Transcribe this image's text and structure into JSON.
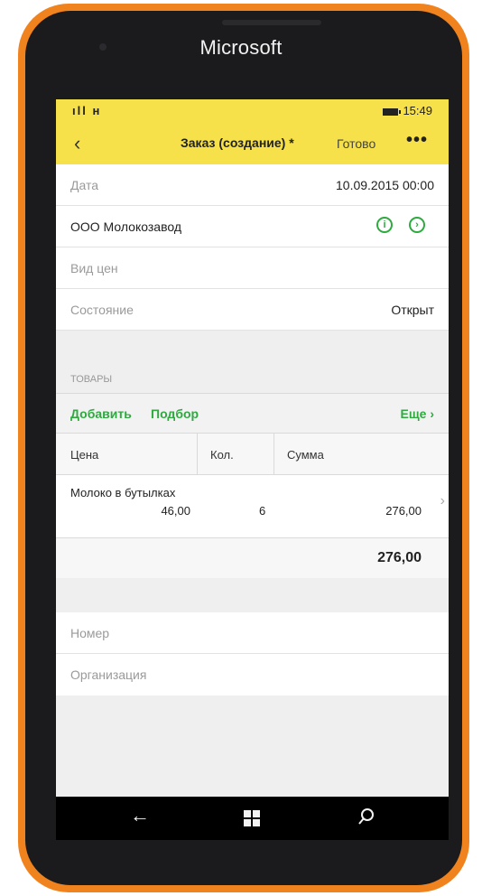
{
  "device": {
    "brand": "Microsoft",
    "frame_color": "#f0831e"
  },
  "status_bar": {
    "signal_text": "ıll н",
    "time": "15:49",
    "background": "#f7e14a"
  },
  "title_bar": {
    "back_icon": "chevron-left-icon",
    "title": "Заказ (создание) *",
    "done_label": "Готово",
    "more_label": "•••"
  },
  "form": {
    "date": {
      "label": "Дата",
      "value": "10.09.2015 00:00"
    },
    "partner": {
      "value": "ООО Молокозавод",
      "info_icon": "info-circle-icon",
      "open_icon": "chevron-right-circle-icon"
    },
    "price_type": {
      "label": "Вид цен"
    },
    "state": {
      "label": "Состояние",
      "value": "Открыт"
    }
  },
  "goods": {
    "section_label": "ТОВАРЫ",
    "add_label": "Добавить",
    "pick_label": "Подбор",
    "more_label": "Еще",
    "columns": [
      "Цена",
      "Кол.",
      "Сумма"
    ],
    "rows": [
      {
        "name": "Молоко в бутылках",
        "price": "46,00",
        "qty": "6",
        "sum": "276,00"
      }
    ],
    "total": "276,00"
  },
  "extra_fields": {
    "number_label": "Номер",
    "org_label": "Организация"
  },
  "nav_bar": {
    "back_icon": "arrow-left-icon",
    "home_icon": "windows-logo-icon",
    "search_icon": "search-icon"
  },
  "colors": {
    "accent": "#2eaa3f",
    "header": "#f7e14a"
  }
}
